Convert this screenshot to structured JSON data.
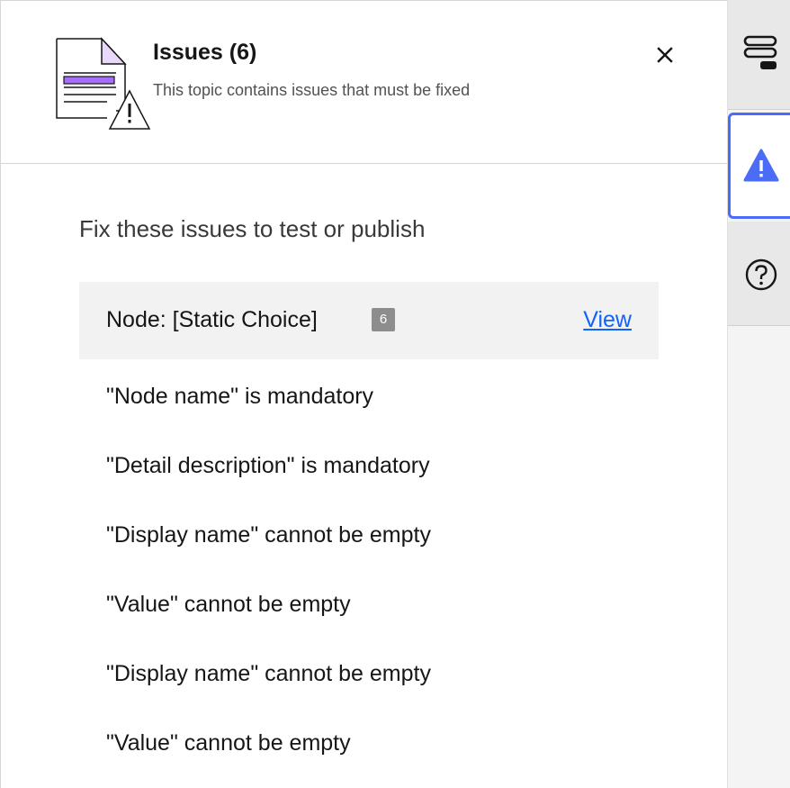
{
  "header": {
    "title": "Issues (6)",
    "subtitle": "This topic contains issues that must be fixed",
    "close_label": "×"
  },
  "content": {
    "heading": "Fix these issues to test or publish",
    "node": {
      "label": "Node: [Static Choice]",
      "count": "6",
      "view_label": "View"
    },
    "issues": [
      "\"Node name\" is mandatory",
      "\"Detail description\" is mandatory",
      "\"Display name\" cannot be empty",
      "\"Value\" cannot be empty",
      "\"Display name\" cannot be empty",
      "\"Value\" cannot be empty"
    ]
  },
  "rail": {
    "items": [
      {
        "icon": "layers-icon"
      },
      {
        "icon": "warning-icon",
        "active": true
      },
      {
        "icon": "help-icon"
      }
    ]
  },
  "colors": {
    "accent": "#4a6cf7",
    "link": "#0f62fe",
    "icon_highlight": "#a66efa",
    "badge": "#8d8d8d",
    "row_bg": "#f2f2f2"
  }
}
